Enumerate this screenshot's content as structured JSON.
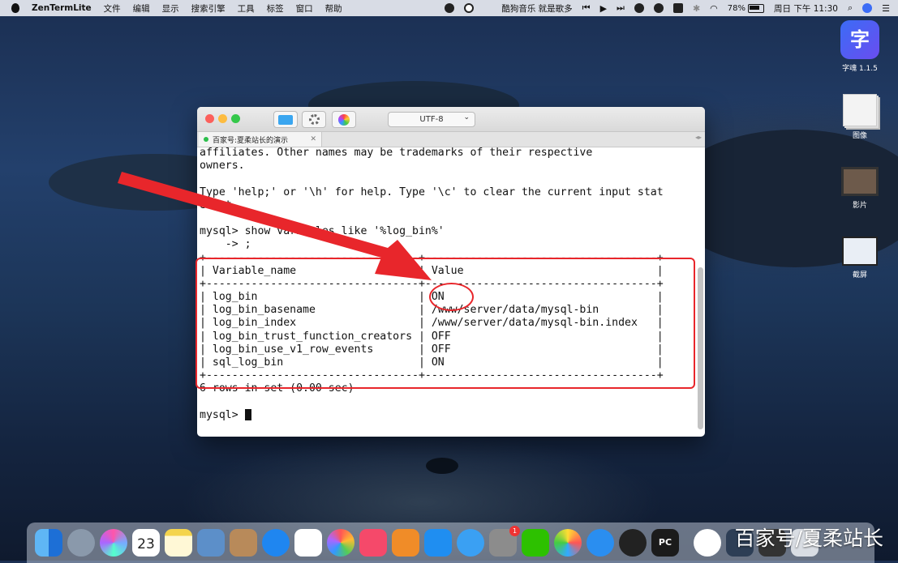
{
  "menubar": {
    "app_name": "ZenTermLite",
    "menus": [
      "文件",
      "编辑",
      "显示",
      "搜索引擎",
      "工具",
      "标签",
      "窗口",
      "帮助"
    ],
    "now_playing": "酷狗音乐 就是歌多",
    "battery": "78%",
    "datetime": "周日 下午 11:30"
  },
  "desktop_icons": [
    {
      "label": "字魂 1.1.5",
      "glyph": "字"
    },
    {
      "label": "图像"
    },
    {
      "label": "影片"
    },
    {
      "label": "截屏"
    }
  ],
  "terminal": {
    "encoding": "UTF-8",
    "tab_title": "百家号:夏柔站长的演示",
    "lines": [
      "affiliates. Other names may be trademarks of their respective",
      "owners.",
      "",
      "Type 'help;' or '\\h' for help. Type '\\c' to clear the current input stat",
      "ement.",
      "",
      "mysql> show variables like '%log_bin%'",
      "    -> ;",
      "+---------------------------------+------------------------------------+",
      "| Variable_name                   | Value                              |",
      "+---------------------------------+------------------------------------+",
      "| log_bin                         | ON                                 |",
      "| log_bin_basename                | /www/server/data/mysql-bin         |",
      "| log_bin_index                   | /www/server/data/mysql-bin.index   |",
      "| log_bin_trust_function_creators | OFF                                |",
      "| log_bin_use_v1_row_events       | OFF                                |",
      "| sql_log_bin                     | ON                                 |",
      "+---------------------------------+------------------------------------+",
      "6 rows in set (0.00 sec)",
      "",
      "mysql> "
    ]
  },
  "colors": {
    "annotation": "#e8262b"
  },
  "dock": {
    "calendar_day": "23",
    "badge_count": "1",
    "pycharm_label": "PC"
  },
  "watermark": "百家号/夏柔站长"
}
